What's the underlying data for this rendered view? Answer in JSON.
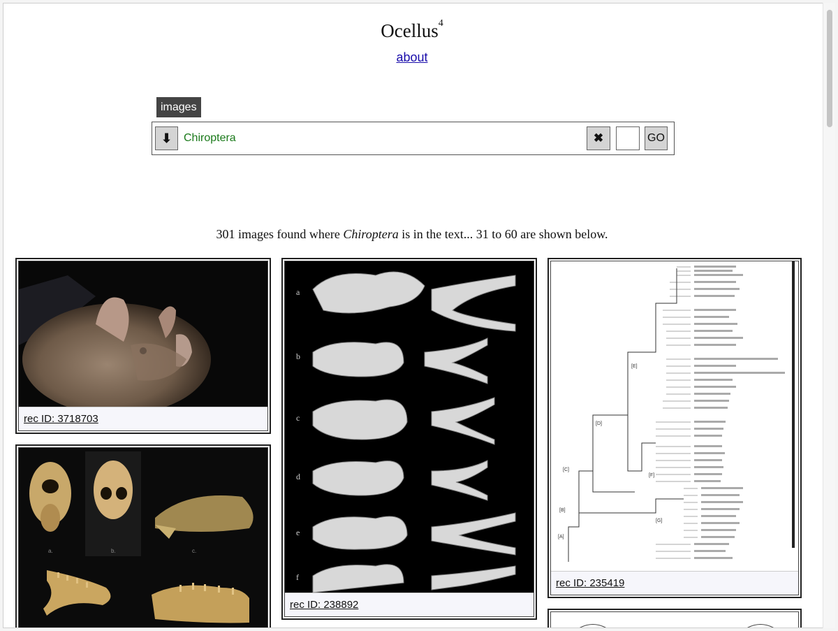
{
  "header": {
    "title": "Ocellus",
    "title_sup": "4",
    "about_link": "about"
  },
  "search": {
    "tab_label": "images",
    "down_icon": "⬇",
    "term": "Chiroptera",
    "clear_icon": "✖",
    "go_label": "GO"
  },
  "results": {
    "prefix": "301 images found where ",
    "term": "Chiroptera",
    "suffix": " is in the text... 31 to 60 are shown below."
  },
  "cards": [
    {
      "caption": "rec ID: 3718703",
      "image": "bat-photo"
    },
    {
      "caption": "rec ID: 238892",
      "image": "bat-skulls-plate"
    },
    {
      "caption": "rec ID: 235419",
      "image": "phylogenetic-tree"
    },
    {
      "caption": "",
      "image": "bat-skull-photos"
    }
  ],
  "tree_labels": [
    "[E]",
    "[D]",
    "[C]",
    "[F]",
    "[B]",
    "[G]",
    "[A]"
  ],
  "plate_labels": [
    "a",
    "b",
    "c",
    "d",
    "e",
    "f"
  ],
  "skull_labels": [
    "a.",
    "b.",
    "c."
  ]
}
